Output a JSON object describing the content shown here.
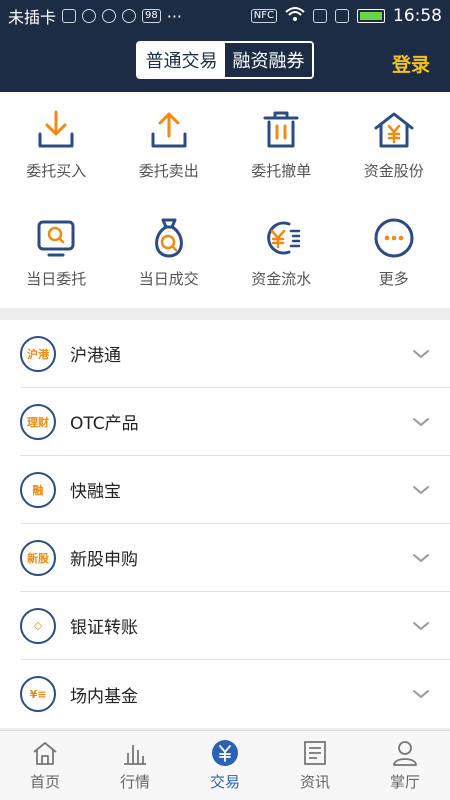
{
  "status_bar": {
    "carrier": "未插卡",
    "badge": "98",
    "nfc": "NFC",
    "time": "16:58"
  },
  "header": {
    "segments": [
      "普通交易",
      "融资融券"
    ],
    "active_segment": "普通交易",
    "login": "登录"
  },
  "grid": [
    {
      "label": "委托买入",
      "icon": "download-tray-icon"
    },
    {
      "label": "委托卖出",
      "icon": "upload-tray-icon"
    },
    {
      "label": "委托撤单",
      "icon": "trash-icon"
    },
    {
      "label": "资金股份",
      "icon": "house-yen-icon"
    },
    {
      "label": "当日委托",
      "icon": "monitor-search-icon"
    },
    {
      "label": "当日成交",
      "icon": "moneybag-search-icon"
    },
    {
      "label": "资金流水",
      "icon": "yen-flow-icon"
    },
    {
      "label": "更多",
      "icon": "more-dots-icon"
    }
  ],
  "list": [
    {
      "label": "沪港通",
      "icon_text": "沪港"
    },
    {
      "label": "OTC产品",
      "icon_text": "理财"
    },
    {
      "label": "快融宝",
      "icon_text": "融"
    },
    {
      "label": "新股申购",
      "icon_text": "新股"
    },
    {
      "label": "银证转账",
      "icon_text": "◇"
    },
    {
      "label": "场内基金",
      "icon_text": "¥≡"
    }
  ],
  "tabs": [
    {
      "label": "首页",
      "icon": "home-icon",
      "active": false
    },
    {
      "label": "行情",
      "icon": "chart-bars-icon",
      "active": false
    },
    {
      "label": "交易",
      "icon": "yen-circle-icon",
      "active": true
    },
    {
      "label": "资讯",
      "icon": "news-icon",
      "active": false
    },
    {
      "label": "掌厅",
      "icon": "person-icon",
      "active": false
    }
  ],
  "colors": {
    "navy": "#1d2c45",
    "accent_orange": "#f08a10",
    "icon_blue": "#2b4b86",
    "login_yellow": "#f5c21a",
    "tab_active": "#2b62b5"
  }
}
